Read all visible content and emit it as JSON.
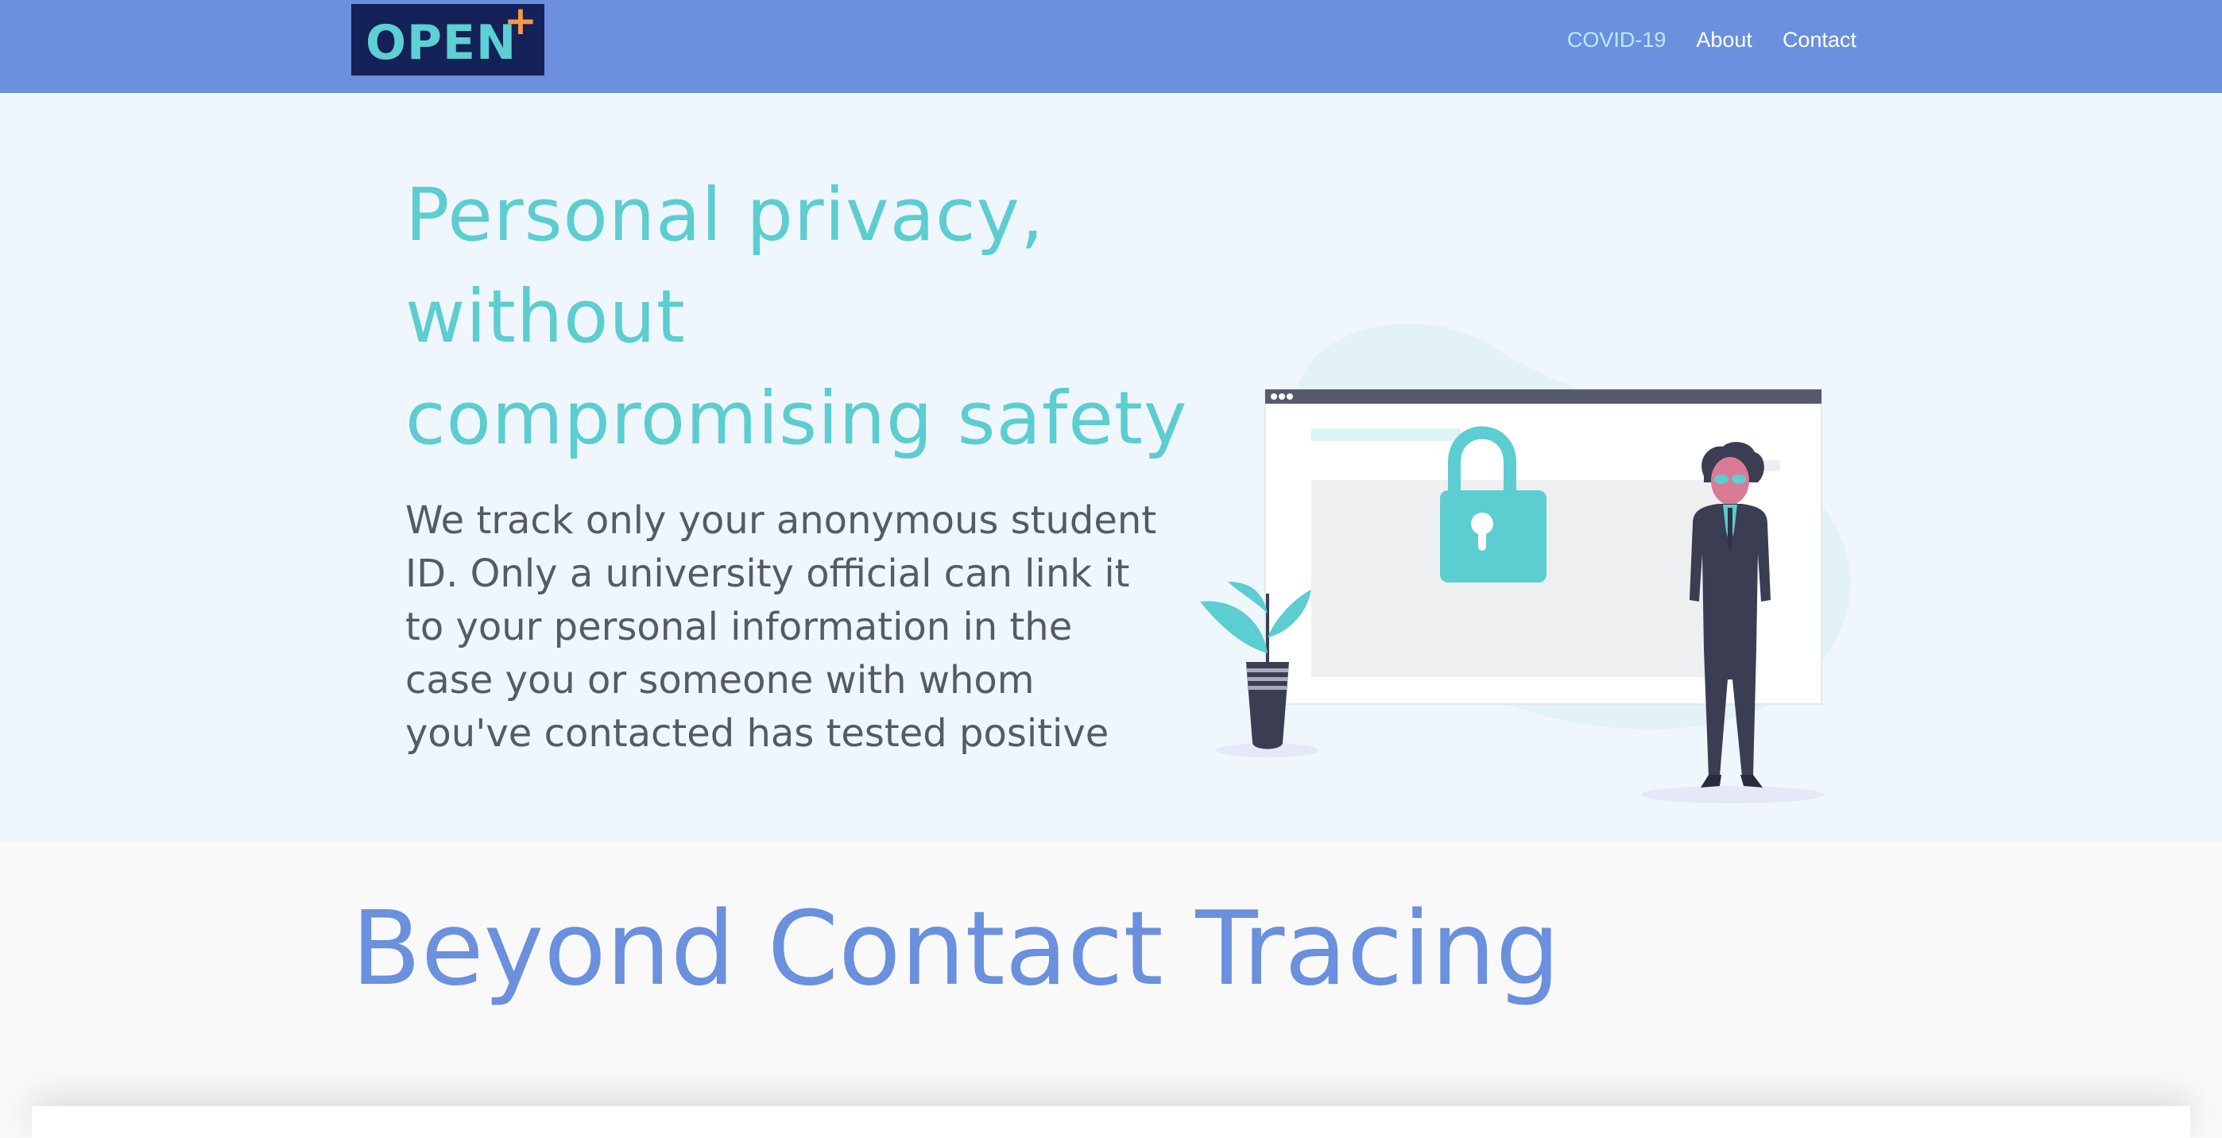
{
  "header": {
    "logo_text": "OPEN",
    "logo_plus": "+",
    "nav": [
      {
        "label": "COVID-19",
        "active": true
      },
      {
        "label": "About",
        "active": false
      },
      {
        "label": "Contact",
        "active": false
      }
    ]
  },
  "hero": {
    "title_line1": "Personal privacy,",
    "title_line2": "without",
    "title_line3": "compromising safety",
    "body": "We track only your anonymous student ID. Only a university official can link it to your personal information in the case you or someone with whom you've contacted has tested positive",
    "illustration_icons": [
      "browser-window",
      "lock-icon",
      "plant-icon",
      "person-figure"
    ]
  },
  "section": {
    "title": "Beyond Contact Tracing"
  },
  "colors": {
    "nav_bg": "#6a90de",
    "logo_bg": "#152159",
    "accent_teal": "#5ccdd0",
    "accent_orange": "#f59a45",
    "hero_bg": "#f0f6fd",
    "body_text": "#555a66"
  }
}
